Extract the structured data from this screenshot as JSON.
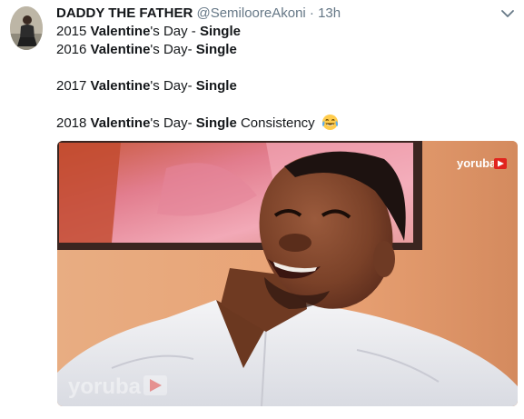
{
  "tweet": {
    "author_name": "DADDY THE FATHER",
    "handle": "@SemilooreAkoni",
    "separator": "·",
    "time": "13h",
    "lines": [
      {
        "year": "2015 ",
        "keyword": "Valentine",
        "mid": "'s Day - ",
        "status": "Single",
        "tail": ""
      },
      {
        "year": "2016 ",
        "keyword": "Valentine",
        "mid": "'s Day- ",
        "status": "Single",
        "tail": ""
      },
      {
        "year": "2017 ",
        "keyword": "Valentine",
        "mid": "'s Day- ",
        "status": "Single",
        "tail": ""
      },
      {
        "year": "2018 ",
        "keyword": "Valentine",
        "mid": "'s Day- ",
        "status": "Single",
        "tail": " Consistency "
      }
    ],
    "emoji": "tears-of-joy-emoji"
  },
  "media": {
    "watermark_top": "yoruba",
    "watermark_bottom": "yoruba"
  },
  "colors": {
    "text": "#14171a",
    "secondary": "#657786",
    "brand_red": "#e1241d"
  }
}
